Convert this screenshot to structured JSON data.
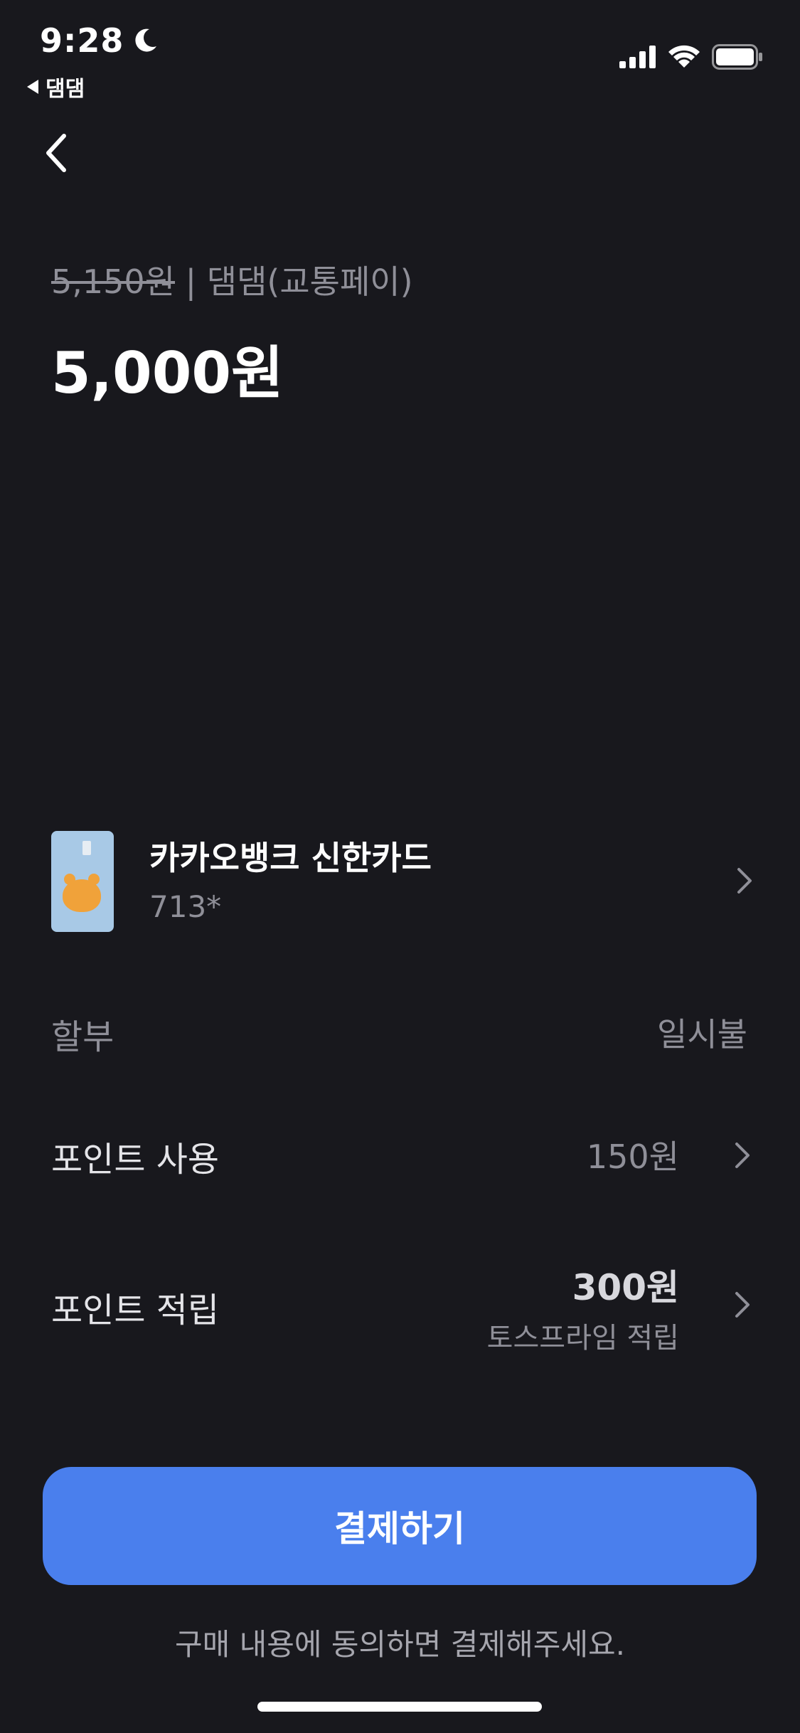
{
  "status_bar": {
    "time": "9:28",
    "back_app_label": "댐댐",
    "icons": [
      "moon-icon",
      "cellular-signal-icon",
      "wifi-icon",
      "battery-icon"
    ]
  },
  "nav": {
    "back_icon": "chevron-left-icon"
  },
  "header": {
    "original_price": "5,150원",
    "separator": "|",
    "merchant": "댐댐(교통페이)",
    "total_amount": "5,000원"
  },
  "payment_method": {
    "card_name": "카카오뱅크 신한카드",
    "card_number": "713*"
  },
  "installment": {
    "label": "할부",
    "value": "일시불"
  },
  "point_use": {
    "label": "포인트 사용",
    "value": "150원"
  },
  "point_earn": {
    "label": "포인트 적립",
    "value": "300원",
    "sub": "토스프라임 적립"
  },
  "pay_button": {
    "label": "결제하기"
  },
  "agreement_text": "구매 내용에 동의하면 결제해주세요.",
  "colors": {
    "background": "#18181d",
    "accent": "#4a7fed",
    "muted_text": "#8f8f98"
  }
}
